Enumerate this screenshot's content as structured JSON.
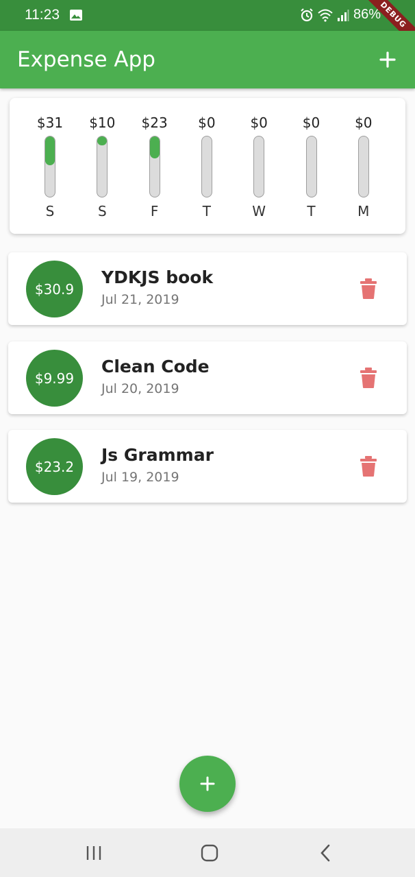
{
  "status_bar": {
    "time": "11:23",
    "battery": "86%"
  },
  "debug_banner": "DEBUG",
  "app_bar": {
    "title": "Expense App",
    "add_icon": "plus-icon"
  },
  "chart": {
    "bars": [
      {
        "day": "S",
        "amount": "$31",
        "fraction": 0.48
      },
      {
        "day": "S",
        "amount": "$10",
        "fraction": 0.15
      },
      {
        "day": "F",
        "amount": "$23",
        "fraction": 0.36
      },
      {
        "day": "T",
        "amount": "$0",
        "fraction": 0
      },
      {
        "day": "W",
        "amount": "$0",
        "fraction": 0
      },
      {
        "day": "T",
        "amount": "$0",
        "fraction": 0
      },
      {
        "day": "M",
        "amount": "$0",
        "fraction": 0
      }
    ]
  },
  "transactions": [
    {
      "amount": "$30.9",
      "title": "YDKJS book",
      "date": "Jul 21, 2019"
    },
    {
      "amount": "$9.99",
      "title": "Clean Code",
      "date": "Jul 20, 2019"
    },
    {
      "amount": "$23.2",
      "title": "Js Grammar",
      "date": "Jul 19, 2019"
    }
  ],
  "colors": {
    "primary": "#4caf50",
    "primary_dark": "#388e3c",
    "delete": "#e57373"
  }
}
